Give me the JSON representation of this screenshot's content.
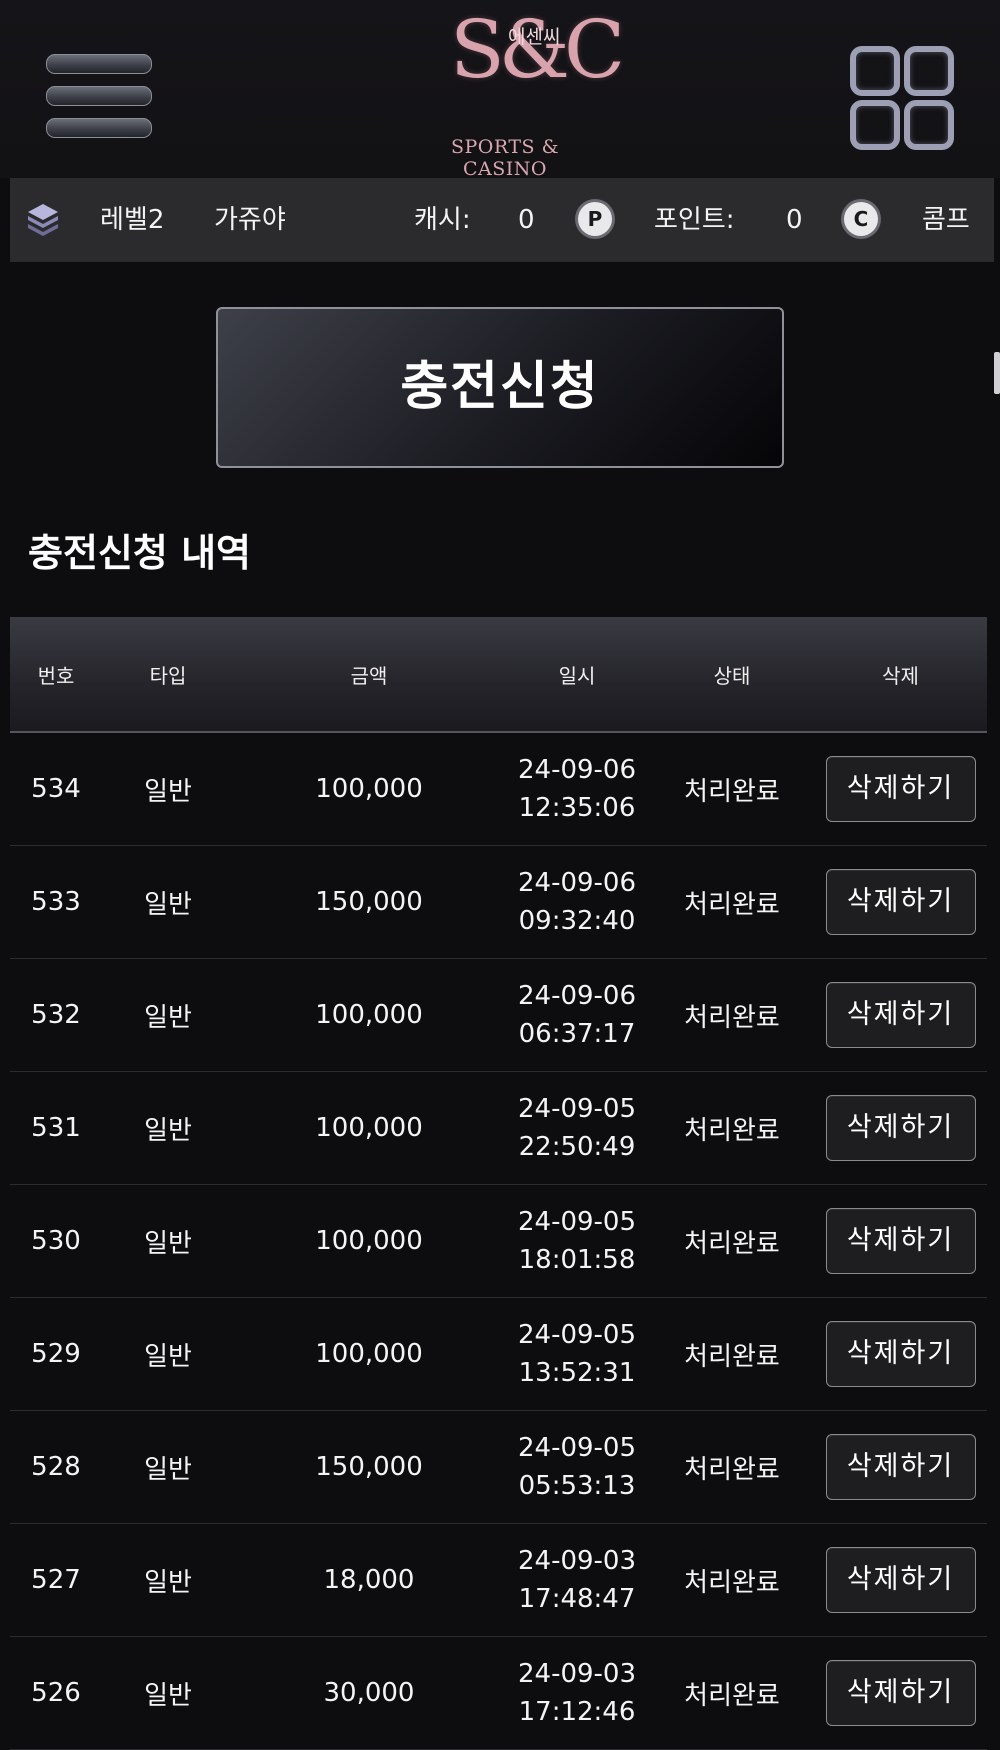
{
  "header": {
    "logo_monogram": "S&C",
    "logo_korean": "에센씨",
    "logo_subtitle": "SPORTS & CASINO",
    "menu_icon": "hamburger-menu-icon",
    "apps_icon": "grid-apps-icon"
  },
  "info_bar": {
    "level": "레벨2",
    "username": "가쥬야",
    "cash_label": "캐시:",
    "cash_value": "0",
    "point_badge": "P",
    "point_label": "포인트:",
    "point_value": "0",
    "comp_badge": "C",
    "comp_label": "콤프"
  },
  "charge_button": "충전신청",
  "history_title": "충전신청 내역",
  "table": {
    "headers": [
      "번호",
      "타입",
      "금액",
      "일시",
      "상태",
      "삭제"
    ],
    "rows": [
      {
        "no": "534",
        "type": "일반",
        "amount": "100,000",
        "date": "24-09-06",
        "time": "12:35:06",
        "status": "처리완료",
        "action": "삭제하기"
      },
      {
        "no": "533",
        "type": "일반",
        "amount": "150,000",
        "date": "24-09-06",
        "time": "09:32:40",
        "status": "처리완료",
        "action": "삭제하기"
      },
      {
        "no": "532",
        "type": "일반",
        "amount": "100,000",
        "date": "24-09-06",
        "time": "06:37:17",
        "status": "처리완료",
        "action": "삭제하기"
      },
      {
        "no": "531",
        "type": "일반",
        "amount": "100,000",
        "date": "24-09-05",
        "time": "22:50:49",
        "status": "처리완료",
        "action": "삭제하기"
      },
      {
        "no": "530",
        "type": "일반",
        "amount": "100,000",
        "date": "24-09-05",
        "time": "18:01:58",
        "status": "처리완료",
        "action": "삭제하기"
      },
      {
        "no": "529",
        "type": "일반",
        "amount": "100,000",
        "date": "24-09-05",
        "time": "13:52:31",
        "status": "처리완료",
        "action": "삭제하기"
      },
      {
        "no": "528",
        "type": "일반",
        "amount": "150,000",
        "date": "24-09-05",
        "time": "05:53:13",
        "status": "처리완료",
        "action": "삭제하기"
      },
      {
        "no": "527",
        "type": "일반",
        "amount": "18,000",
        "date": "24-09-03",
        "time": "17:48:47",
        "status": "처리완료",
        "action": "삭제하기"
      },
      {
        "no": "526",
        "type": "일반",
        "amount": "30,000",
        "date": "24-09-03",
        "time": "17:12:46",
        "status": "처리완료",
        "action": "삭제하기"
      }
    ]
  },
  "colors": {
    "background": "#0d0d0f",
    "info_bar": "#2b2b2e",
    "logo_pink": "#d9a3ad",
    "icon_lavender": "#9da0b4"
  }
}
